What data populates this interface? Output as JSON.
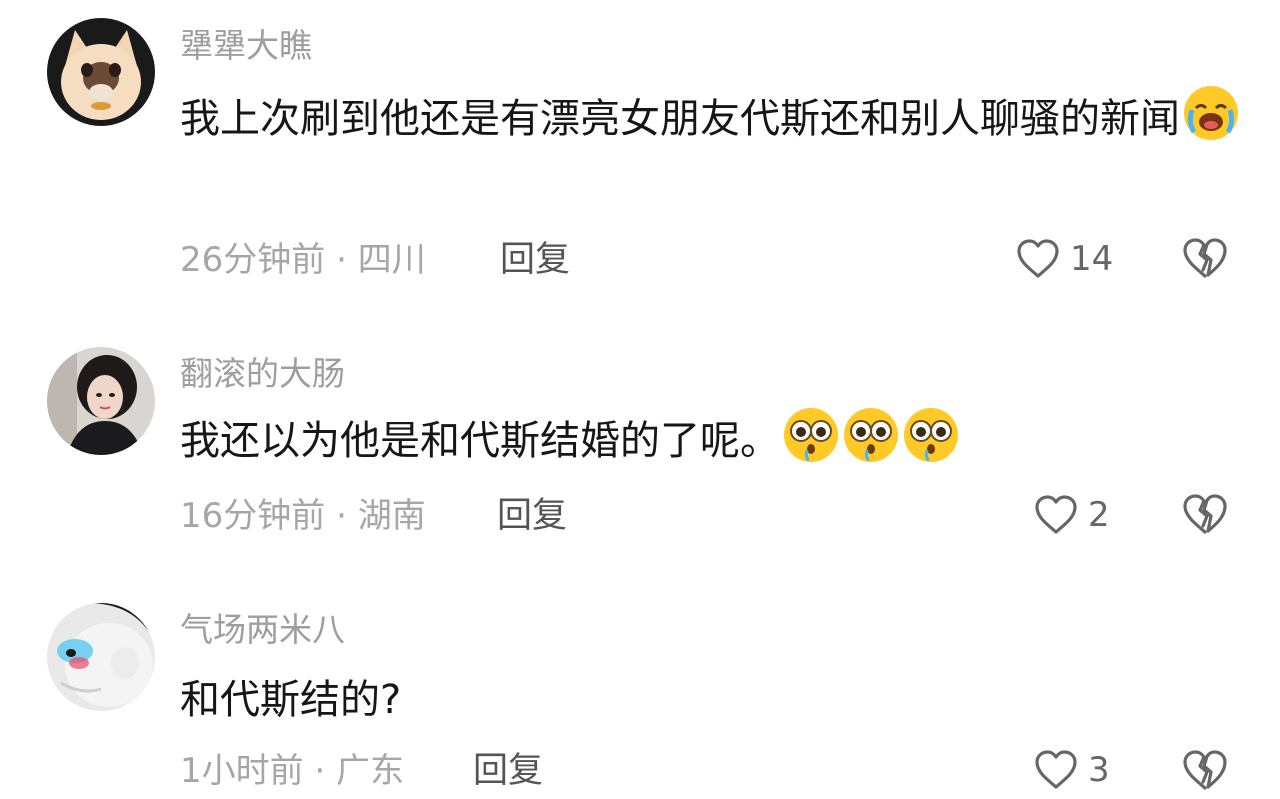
{
  "comments": [
    {
      "username": "犟犟大瞧",
      "text": "我上次刷到他还是有漂亮女朋友代斯还和别人聊骚的新闻",
      "emoji": [
        "loudly-crying-emoji"
      ],
      "time": "26分钟前",
      "location": "四川",
      "reply_label": "回复",
      "likes": "14"
    },
    {
      "username": "翻滚的大肠",
      "text": "我还以为他是和代斯结婚的了呢。",
      "emoji": [
        "pleading-emoji",
        "pleading-emoji",
        "pleading-emoji"
      ],
      "time": "16分钟前",
      "location": "湖南",
      "reply_label": "回复",
      "likes": "2"
    },
    {
      "username": "气场两米八",
      "text": "和代斯结的?",
      "emoji": [],
      "time": "1小时前",
      "location": "广东",
      "reply_label": "回复",
      "likes": "3"
    }
  ],
  "meta_separator": "·",
  "icons": {
    "like": "heart-outline-icon",
    "dislike": "broken-heart-icon"
  },
  "colors": {
    "username": "#9e9e9e",
    "text": "#161616",
    "meta": "#a6a6a6",
    "reply": "#555555",
    "emoji_face": "#ffc928"
  }
}
